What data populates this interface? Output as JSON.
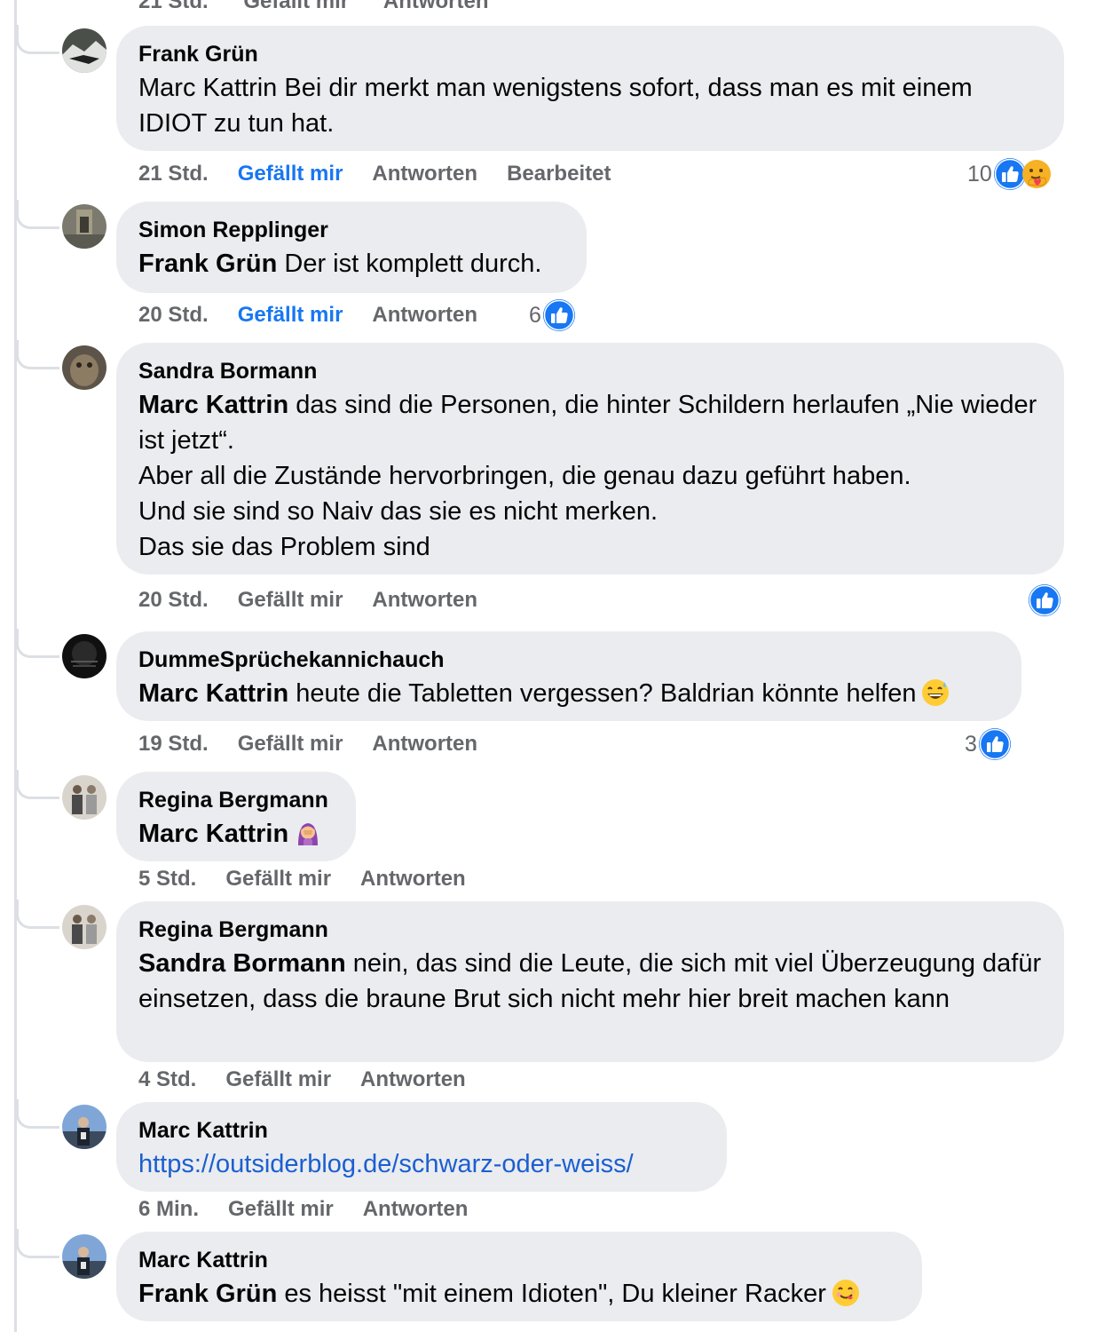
{
  "top_meta": {
    "time": "21 Std.",
    "like": "Gefällt mir",
    "reply": "Antworten"
  },
  "comments": [
    {
      "author": "Frank Grün",
      "text": "Marc Kattrin Bei dir merkt man wenigstens sofort, dass man es mit einem IDIOT zu tun hat.",
      "time": "21 Std.",
      "like": "Gefällt mir",
      "reply": "Antworten",
      "edited": "Bearbeitet",
      "reaction_count": "10"
    },
    {
      "author": "Simon Repplinger",
      "mention": "Frank Grün",
      "text": " Der ist komplett durch.",
      "time": "20 Std.",
      "like": "Gefällt mir",
      "reply": "Antworten",
      "reaction_count": "6"
    },
    {
      "author": "Sandra Bormann",
      "mention": "Marc Kattrin",
      "text_1": " das sind die Personen, die hinter Schildern herlaufen „Nie wieder ist jetzt“.",
      "text_2": "Aber all die Zustände hervorbringen, die genau dazu geführt haben.",
      "text_3": "Und sie sind so Naiv das sie es nicht merken.",
      "text_4": "Das sie das Problem sind",
      "time": "20 Std.",
      "like": "Gefällt mir",
      "reply": "Antworten"
    },
    {
      "author": "DummeSprüchekannichauch",
      "mention": "Marc Kattrin",
      "text": " heute die Tabletten vergessen? Baldrian könnte helfen",
      "time": "19 Std.",
      "like": "Gefällt mir",
      "reply": "Antworten",
      "reaction_count": "3"
    },
    {
      "author": "Regina Bergmann",
      "mention": "Marc Kattrin",
      "time": "5 Std.",
      "like": "Gefällt mir",
      "reply": "Antworten"
    },
    {
      "author": "Regina Bergmann",
      "mention": "Sandra Bormann",
      "text": " nein, das sind die Leute, die sich mit viel Überzeugung dafür einsetzen, dass die braune Brut sich nicht mehr hier breit machen kann",
      "time": "4 Std.",
      "like": "Gefällt mir",
      "reply": "Antworten"
    },
    {
      "author": "Marc Kattrin",
      "link": "https://outsiderblog.de/schwarz-oder-weiss/",
      "time": "6 Min.",
      "like": "Gefällt mir",
      "reply": "Antworten"
    },
    {
      "author": "Marc Kattrin",
      "mention": "Frank Grün",
      "text": " es heisst \"mit einem Idioten\", Du kleiner Racker"
    }
  ],
  "colors": {
    "bubble": "#eaecf0",
    "like_blue": "#1877f2",
    "meta_gray": "#65676b",
    "link": "#1b5fd0"
  }
}
